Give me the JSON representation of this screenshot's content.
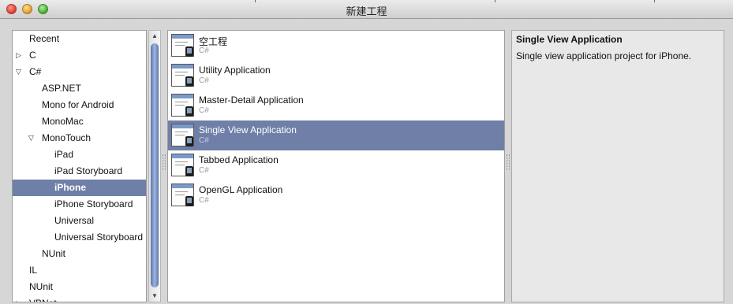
{
  "window": {
    "title": "新建工程"
  },
  "tree": {
    "items": [
      {
        "label": "Recent",
        "arrow": ""
      },
      {
        "label": "C",
        "arrow": "▷"
      },
      {
        "label": "C#",
        "arrow": "▽"
      },
      {
        "label": "ASP.NET",
        "arrow": ""
      },
      {
        "label": "Mono for Android",
        "arrow": ""
      },
      {
        "label": "MonoMac",
        "arrow": ""
      },
      {
        "label": "MonoTouch",
        "arrow": "▽"
      },
      {
        "label": "iPad",
        "arrow": ""
      },
      {
        "label": "iPad Storyboard",
        "arrow": ""
      },
      {
        "label": "iPhone",
        "arrow": ""
      },
      {
        "label": "iPhone Storyboard",
        "arrow": ""
      },
      {
        "label": "Universal",
        "arrow": ""
      },
      {
        "label": "Universal Storyboard",
        "arrow": ""
      },
      {
        "label": "NUnit",
        "arrow": ""
      },
      {
        "label": "IL",
        "arrow": ""
      },
      {
        "label": "NUnit",
        "arrow": ""
      },
      {
        "label": "VBNet",
        "arrow": "▷"
      }
    ],
    "selected": "iPhone"
  },
  "scrollbar": {
    "up_arrow": "▲",
    "down_arrow": "▼"
  },
  "templates": {
    "items": [
      {
        "name": "空工程",
        "lang": "C#"
      },
      {
        "name": "Utility Application",
        "lang": "C#"
      },
      {
        "name": "Master-Detail Application",
        "lang": "C#"
      },
      {
        "name": "Single View Application",
        "lang": "C#"
      },
      {
        "name": "Tabbed Application",
        "lang": "C#"
      },
      {
        "name": "OpenGL Application",
        "lang": "C#"
      }
    ],
    "selected": "Single View Application"
  },
  "description": {
    "title": "Single View Application",
    "body": "Single view application project for iPhone."
  },
  "colors": {
    "selection": "#6f7fa8",
    "panel_bg": "#ffffff",
    "window_bg": "#d6d6d6",
    "scroll_thumb": "#7d96c6"
  },
  "icons": {
    "tree_collapsed": "triangle-right-icon",
    "tree_expanded": "triangle-down-icon",
    "template": "project-template-icon",
    "window_close": "close-icon",
    "window_minimize": "minimize-icon",
    "window_maximize": "maximize-icon"
  }
}
